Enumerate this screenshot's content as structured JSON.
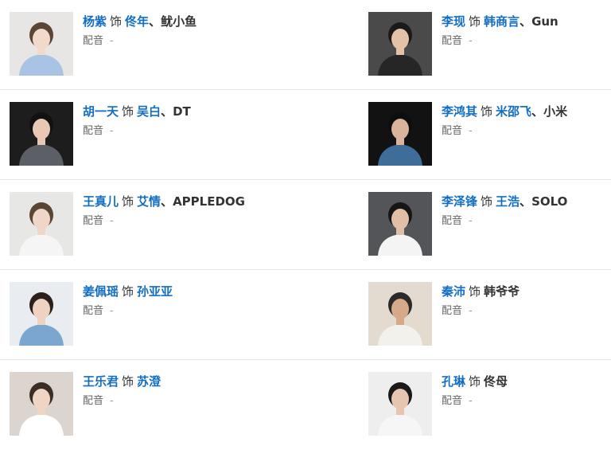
{
  "verb": "饰",
  "role_label": "配音",
  "role_value": "-",
  "rows": [
    [
      {
        "actor": "杨紫",
        "actor_link": true,
        "characters": [
          {
            "name": "佟年",
            "link": true
          },
          {
            "name": "鱿小鱼",
            "link": false
          }
        ],
        "photo": {
          "bg": "#e8e6e4",
          "skin": "#f2d9c9",
          "hair": "#5a4536",
          "top": "#a9c3e4"
        }
      },
      {
        "actor": "李现",
        "actor_link": true,
        "characters": [
          {
            "name": "韩商言",
            "link": true
          },
          {
            "name": "Gun",
            "link": false
          }
        ],
        "photo": {
          "bg": "#4a4a4a",
          "skin": "#e4c2a8",
          "hair": "#1a1a1a",
          "top": "#262626"
        }
      }
    ],
    [
      {
        "actor": "胡一天",
        "actor_link": true,
        "characters": [
          {
            "name": "吴白",
            "link": true
          },
          {
            "name": "DT",
            "link": false
          }
        ],
        "photo": {
          "bg": "#1d1d1d",
          "skin": "#e8c8b4",
          "hair": "#111111",
          "top": "#5d5f66"
        }
      },
      {
        "actor": "李鸿其",
        "actor_link": true,
        "characters": [
          {
            "name": "米邵飞",
            "link": true
          },
          {
            "name": "小米",
            "link": false
          }
        ],
        "photo": {
          "bg": "#121212",
          "skin": "#d9b49a",
          "hair": "#0e0e0e",
          "top": "#3f6d9a"
        }
      }
    ],
    [
      {
        "actor": "王真儿",
        "actor_link": true,
        "characters": [
          {
            "name": "艾情",
            "link": true
          },
          {
            "name": "APPLEDOG",
            "link": false
          }
        ],
        "photo": {
          "bg": "#e7e7e5",
          "skin": "#f0d6c6",
          "hair": "#5a4634",
          "top": "#f5f5f5"
        }
      },
      {
        "actor": "李泽锋",
        "actor_link": true,
        "characters": [
          {
            "name": "王浩",
            "link": true
          },
          {
            "name": "SOLO",
            "link": false
          }
        ],
        "photo": {
          "bg": "#535559",
          "skin": "#e1bfa6",
          "hair": "#161616",
          "top": "#f4f4f4"
        }
      }
    ],
    [
      {
        "actor": "姜佩瑶",
        "actor_link": true,
        "characters": [
          {
            "name": "孙亚亚",
            "link": true
          }
        ],
        "photo": {
          "bg": "#e9ecf0",
          "skin": "#efd2c0",
          "hair": "#2b211c",
          "top": "#7aa6cf"
        }
      },
      {
        "actor": "秦沛",
        "actor_link": true,
        "characters": [
          {
            "name": "韩爷爷",
            "link": false
          }
        ],
        "photo": {
          "bg": "#e3dbd0",
          "skin": "#d6a98a",
          "hair": "#2a2a2a",
          "top": "#f3f1ec"
        }
      }
    ],
    [
      {
        "actor": "王乐君",
        "actor_link": true,
        "characters": [
          {
            "name": "苏澄",
            "link": true
          }
        ],
        "photo": {
          "bg": "#dcd5cf",
          "skin": "#f0d5c4",
          "hair": "#3b2e27",
          "top": "#ffffff"
        }
      },
      {
        "actor": "孔琳",
        "actor_link": true,
        "characters": [
          {
            "name": "佟母",
            "link": false
          }
        ],
        "photo": {
          "bg": "#eeeeee",
          "skin": "#e7c6b1",
          "hair": "#1a1a1a",
          "top": "#f6f6f6"
        }
      }
    ]
  ]
}
